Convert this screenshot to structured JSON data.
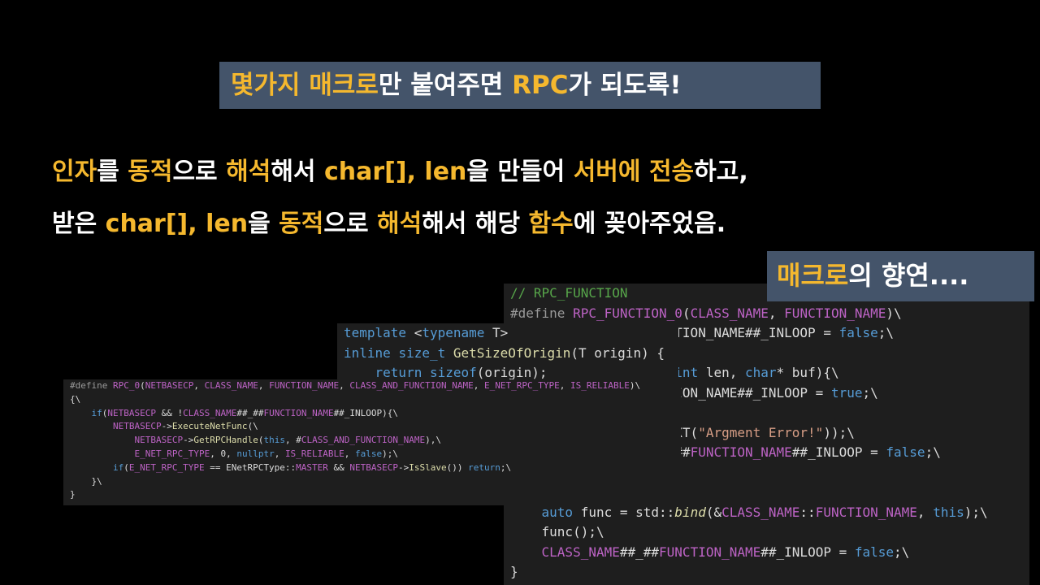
{
  "title": {
    "parts": [
      "몇가지 매크로",
      "만 붙여주면 ",
      "RPC",
      "가 되도록!"
    ]
  },
  "line1": {
    "parts": [
      "인자",
      "를 ",
      "동적",
      "으로 ",
      "해석",
      "해서 ",
      "char[], len",
      "을 만들어 ",
      "서버에 전송",
      "하고,"
    ]
  },
  "line2": {
    "parts": [
      "받은 ",
      "char[], len",
      "을 ",
      "동적",
      "으로 ",
      "해석",
      "해서 해당 ",
      "함수",
      "에 꽂아주었음."
    ]
  },
  "macro_caption": {
    "parts": [
      "매크로",
      "의 향연...."
    ]
  },
  "colors": {
    "highlight": "#f5b82e",
    "box_bg": "#44546a",
    "code_bg": "#1e1e1e"
  },
  "code_big": [
    "// RPC_FUNCTION",
    "#define RPC_FUNCTION_0(CLASS_NAME, FUNCTION_NAME)\\",
    "                    CTION_NAME##_INLOOP = false;\\",
    "",
    "                    (int len, char* buf){\\",
    "                    TION_NAME##_INLOOP = true;\\",
    "",
    "                    EXT(\"Argment Error!\"));\\",
    "                    _##FUNCTION_NAME##_INLOOP = false;\\",
    "",
    "",
    "    auto func = std::bind(&CLASS_NAME::FUNCTION_NAME, this);\\",
    "    func();\\",
    "    CLASS_NAME##_##FUNCTION_NAME##_INLOOP = false;\\",
    "}"
  ],
  "code_mid": [
    "template <typename T>",
    "inline size_t GetSizeOfOrigin(T origin) {",
    "    return sizeof(origin);"
  ],
  "code_small": [
    "#define RPC_0(NETBASECP, CLASS_NAME, FUNCTION_NAME, CLASS_AND_FUNCTION_NAME, E_NET_RPC_TYPE, IS_RELIABLE)\\",
    "{\\",
    "    if(NETBASECP && !CLASS_NAME##_##FUNCTION_NAME##_INLOOP){\\",
    "        NETBASECP->ExecuteNetFunc(\\",
    "            NETBASECP->GetRPCHandle(this, #CLASS_AND_FUNCTION_NAME),\\",
    "            E_NET_RPC_TYPE, 0, nullptr, IS_RELIABLE, false);\\",
    "        if(E_NET_RPC_TYPE == ENetRPCType::MASTER && NETBASECP->IsSlave()) return;\\",
    "    }\\",
    "}"
  ]
}
